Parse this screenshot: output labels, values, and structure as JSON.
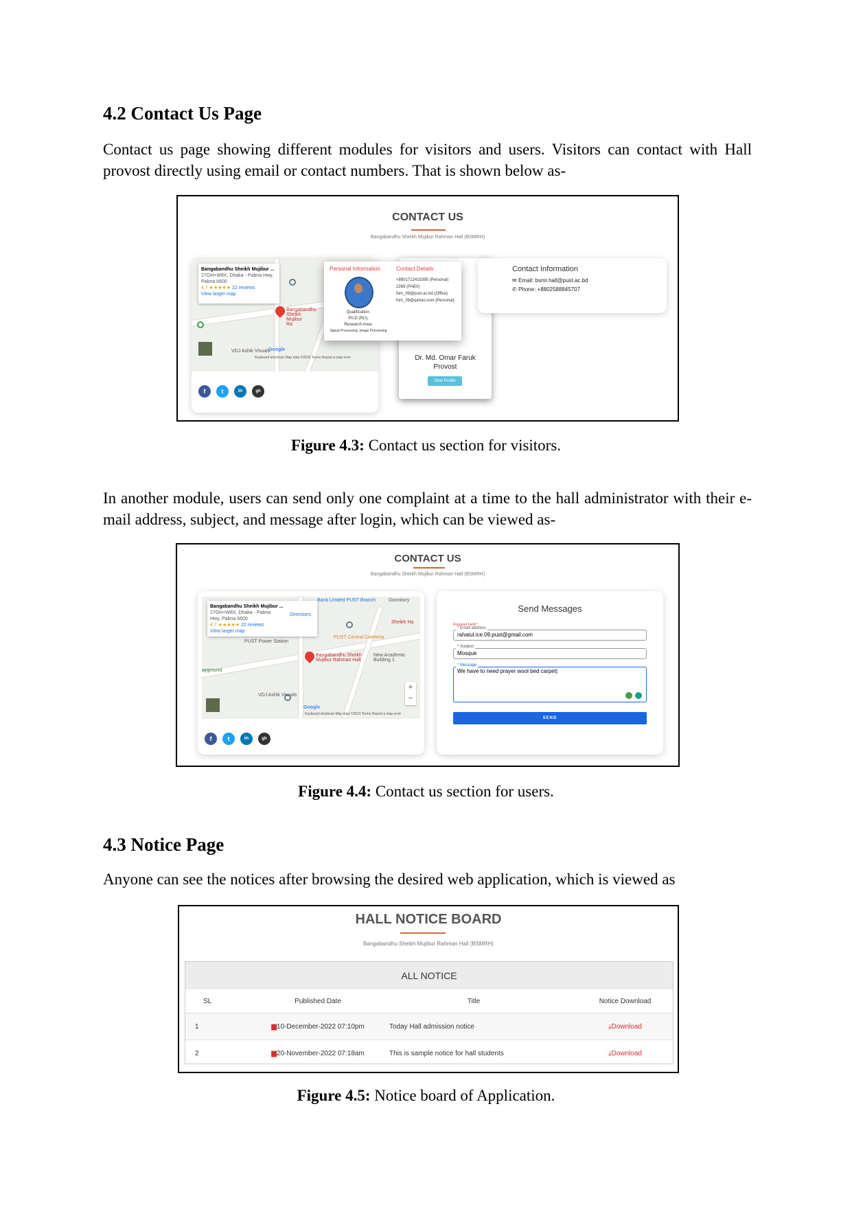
{
  "section_42": {
    "heading": "4.2 Contact Us Page",
    "paragraph": "Contact us page showing different modules for visitors and users. Visitors can contact with Hall provost directly using email or contact numbers. That is shown below as-"
  },
  "fig43": {
    "title": "CONTACT US",
    "subtitle": "Bangabandhu Sheikh Mujibur Rahman Hall (BSMRH)",
    "map": {
      "place_name": "Bangabandhu Sheikh Mujibur ...",
      "address": "27GH+W8X, Dhaka - Pabna Hwy, Pabna 6600",
      "rating": "4.7 ★★★★★",
      "reviews": "22 reviews",
      "larger_map": "View larger map",
      "pin_label": "Bangabandhu Sheikh Mujibur Ra",
      "label_vdj": "VDJ Ashik Visuals",
      "google": "Google",
      "footer": "Keyboard shortcuts    Map data ©2023    Terms    Report a map error"
    },
    "popup": {
      "personal_heading": "Personal Information",
      "contact_heading": "Contact Details",
      "qualification_label": "Qualification:",
      "qualification_value": "Ph.D (RU),",
      "research_label": "Research Area:",
      "research_value": "Signal Processing, Image Processing",
      "contact_lines": [
        "+8801712415395 (Personal)",
        "2268 (PABX)",
        "fom_09@pust.ac.bd (Office)",
        "fom_09@yahoo.com (Personal)"
      ]
    },
    "provost": {
      "name": "Dr. Md. Omar Faruk",
      "role": "Provost",
      "button": "View Profile"
    },
    "contact_info": {
      "heading": "Contact Information",
      "email": "Email: bsmr.hall@pust.ac.bd",
      "phone": "Phone: +8802588845707"
    },
    "social": [
      "f",
      "t",
      "in",
      "gh"
    ]
  },
  "caption43": {
    "label": "Figure 4.3:",
    "text": " Contact us section for visitors."
  },
  "para_users": "In another module, users can send only one complaint at a time to the hall administrator with their e-mail address, subject, and message after login, which can be viewed as-",
  "fig44": {
    "title": "CONTACT US",
    "subtitle": "Bangabandhu Sheikh Mujibur Rahman Hall (BSMRH)",
    "map": {
      "place_name": "Bangabandhu Sheikh Mujibur ...",
      "address": "27GH+W8X, Dhaka - Pabna Hwy, Pabna 6600",
      "rating": "4.7 ★★★★★",
      "reviews": "22 reviews",
      "larger_map": "View larger map",
      "directions": "Directions",
      "bank": "Bank Limited PUST Branch",
      "dormitory": "Dormitory",
      "sheikh": "Sheikh Ha",
      "cafeteria": "PUST Central Cafeteria",
      "power": "PUST Power Station",
      "hall_pin": "Bangabandhu Sheikh Mujibur Rahman Hall",
      "academic": "New Academic Building 1",
      "ground": "ayground",
      "label_vdj": "VDJ Ashik Visuals",
      "google": "Google",
      "footer": "Keyboard shortcuts    Map data ©2023    Terms    Report a map error"
    },
    "form": {
      "heading": "Send Messages",
      "required": "Required Field *",
      "email_label": "* Email address",
      "email_value": "rahatul.ice.09.pust@gmail.com",
      "subject_label": "* Subject",
      "subject_value": "Mosque",
      "message_label": "* Message",
      "message_value": "We have to need prayer wool bed carpet|",
      "send": "SEND"
    },
    "social": [
      "f",
      "t",
      "in",
      "gh"
    ]
  },
  "caption44": {
    "label": "Figure 4.4:",
    "text": " Contact us section for users."
  },
  "section_43": {
    "heading": "4.3 Notice Page",
    "paragraph": "Anyone can see the notices after browsing the desired web application, which is viewed as"
  },
  "fig45": {
    "title": "HALL NOTICE BOARD",
    "subtitle": "Bangabandhu Sheikh Mujibur Rahman Hall (BSMRH)",
    "bar": "ALL NOTICE",
    "headers": [
      "SL",
      "Published Date",
      "Title",
      "Notice Download"
    ],
    "rows": [
      {
        "sl": "1",
        "date": "10-December-2022 07:10pm",
        "title": "Today Hall admission notice",
        "download": "Download"
      },
      {
        "sl": "2",
        "date": "20-November-2022 07:18am",
        "title": "This is sample notice for hall students",
        "download": "Download"
      }
    ]
  },
  "caption45": {
    "label": "Figure 4.5:",
    "text": " Notice board of Application."
  },
  "colors": {
    "accent": "#c9673b",
    "send_button": "#1a66e0",
    "danger": "#d32f2f",
    "facebook": "#3b5998",
    "twitter": "#1da1f2",
    "linkedin": "#0077b5",
    "github": "#333333"
  }
}
